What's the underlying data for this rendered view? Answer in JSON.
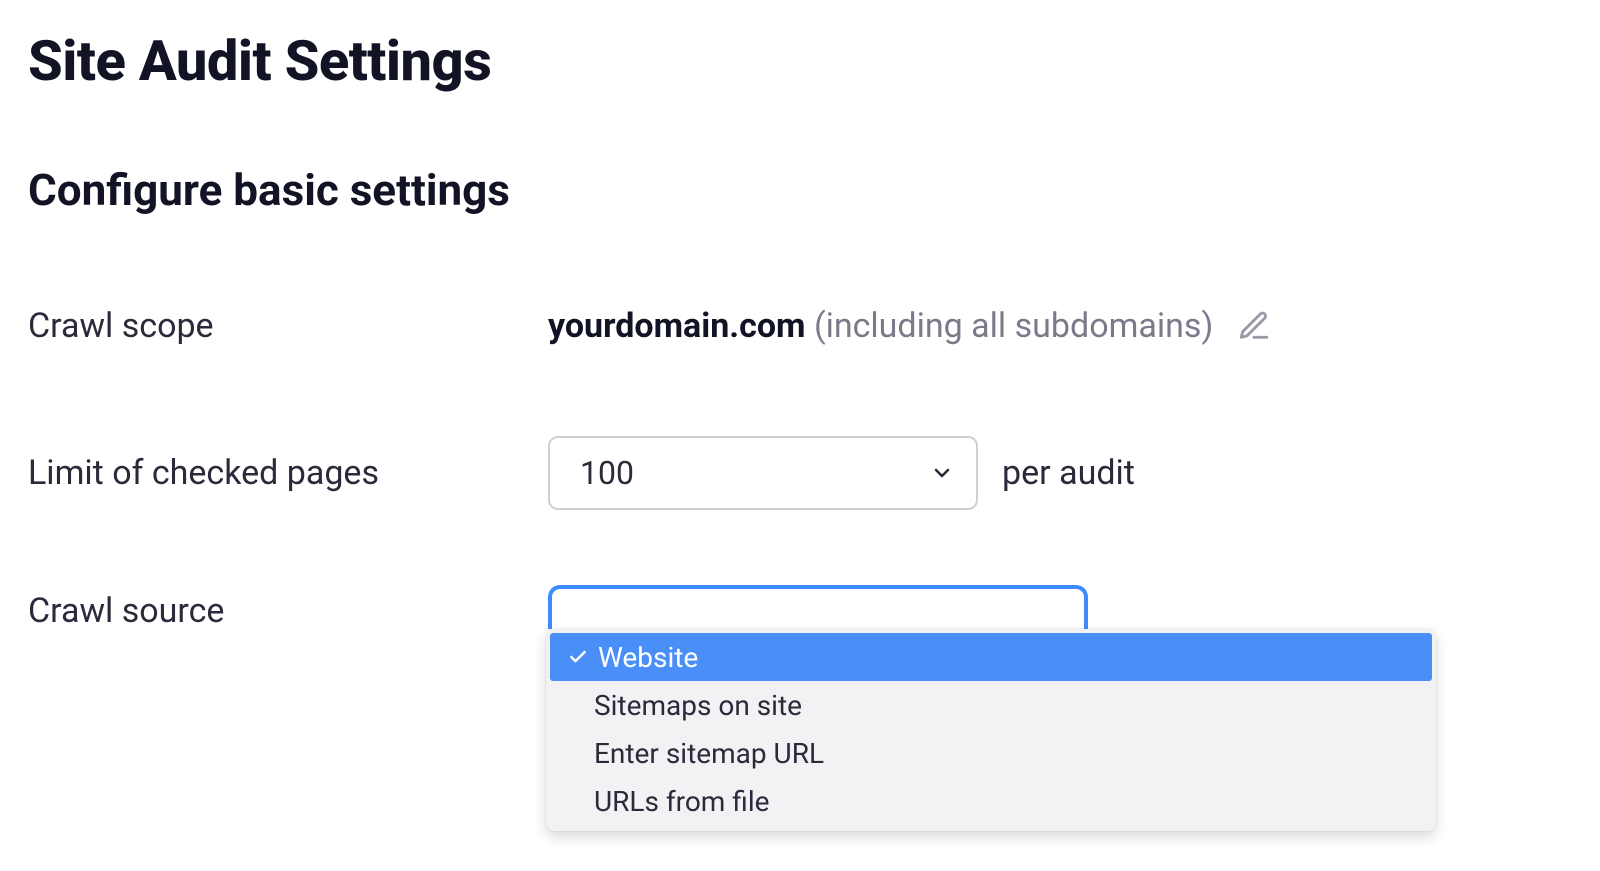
{
  "header": {
    "title": "Site Audit Settings"
  },
  "section": {
    "title": "Configure basic settings"
  },
  "crawl_scope": {
    "label": "Crawl scope",
    "domain": "yourdomain.com",
    "note": "(including all subdomains)"
  },
  "limit_pages": {
    "label": "Limit of checked pages",
    "selected_value": "100",
    "suffix": "per audit"
  },
  "crawl_source": {
    "label": "Crawl source",
    "selected": "Website",
    "options": [
      "Website",
      "Sitemaps on site",
      "Enter sitemap URL",
      "URLs from file"
    ]
  }
}
